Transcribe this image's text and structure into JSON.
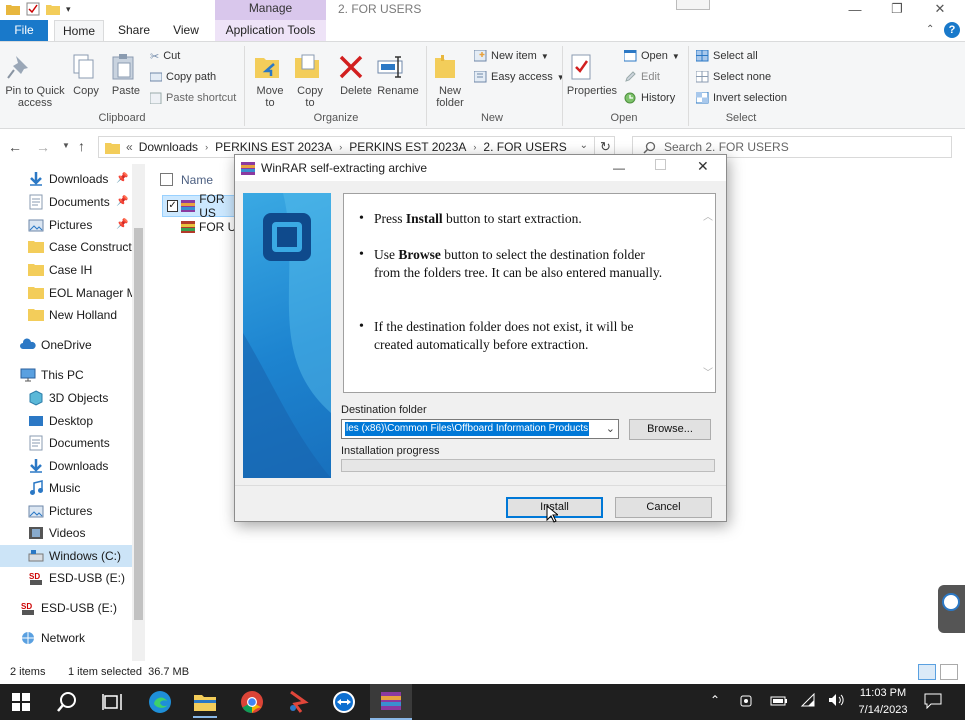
{
  "window": {
    "context_tab": "Manage",
    "title": "2. FOR USERS",
    "minimize": "—",
    "maximize": "❐",
    "close": "✕"
  },
  "tabs": {
    "file": "File",
    "home": "Home",
    "share": "Share",
    "view": "View",
    "app_tools": "Application Tools"
  },
  "ribbon": {
    "pin": "Pin to Quick access",
    "copy": "Copy",
    "paste": "Paste",
    "cut": "Cut",
    "copy_path": "Copy path",
    "paste_shortcut": "Paste shortcut",
    "clipboard": "Clipboard",
    "move_to": "Move to",
    "copy_to": "Copy to",
    "delete": "Delete",
    "rename": "Rename",
    "organize": "Organize",
    "new_folder": "New folder",
    "new_item": "New item",
    "easy_access": "Easy access",
    "new": "New",
    "properties": "Properties",
    "open": "Open",
    "edit": "Edit",
    "history": "History",
    "open_group": "Open",
    "select_all": "Select all",
    "select_none": "Select none",
    "invert_selection": "Invert selection",
    "select": "Select"
  },
  "address": {
    "crumbs": [
      "Downloads",
      "PERKINS EST 2023A",
      "PERKINS EST 2023A",
      "2. FOR USERS"
    ],
    "search_placeholder": "Search 2. FOR USERS"
  },
  "nav": {
    "quick": [
      "Downloads",
      "Documents",
      "Pictures",
      "Case Constructio",
      "Case IH",
      "EOL Manager M",
      "New Holland"
    ],
    "onedrive": "OneDrive",
    "thispc": "This PC",
    "pc": [
      "3D Objects",
      "Desktop",
      "Documents",
      "Downloads",
      "Music",
      "Pictures",
      "Videos",
      "Windows (C:)",
      "ESD-USB (E:)"
    ],
    "esd": "ESD-USB (E:)",
    "network": "Network"
  },
  "files": {
    "header_name": "Name",
    "rows": [
      "FOR US",
      "FOR US"
    ]
  },
  "dialog": {
    "title": "WinRAR self-extracting archive",
    "b1_pre": "Press ",
    "b1_bold": "Install",
    "b1_post": " button to start extraction.",
    "b2_pre": "Use ",
    "b2_bold": "Browse",
    "b2_post": " button to select the destination folder from the folders tree. It can be also entered manually.",
    "b3": "If the destination folder does not exist, it will be created automatically before extraction.",
    "dest_label": "Destination folder",
    "dest_value": "les (x86)\\Common Files\\Offboard Information Products",
    "browse": "Browse...",
    "progress_label": "Installation progress",
    "progress": 0,
    "install": "Install",
    "cancel": "Cancel"
  },
  "status": {
    "items": "2 items",
    "selected": "1 item selected  36.7 MB"
  },
  "taskbar": {
    "time": "11:03 PM",
    "date": "7/14/2023"
  }
}
